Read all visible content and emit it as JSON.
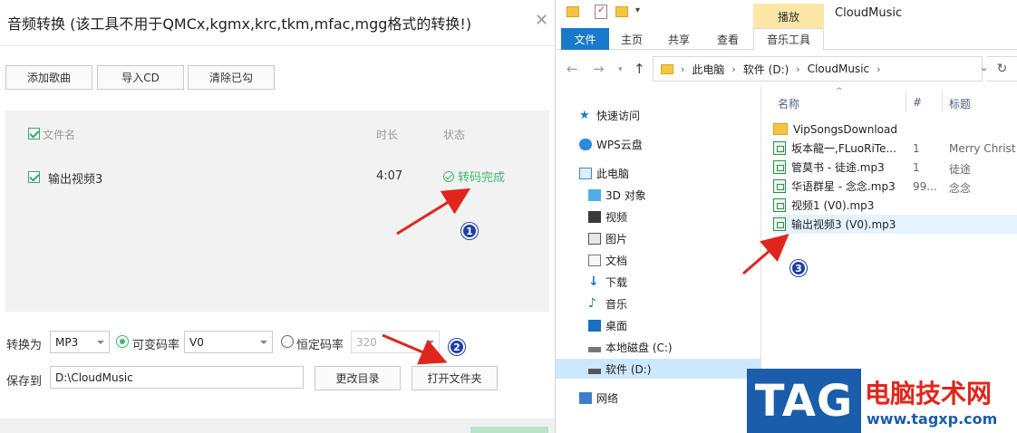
{
  "dialog": {
    "title": "音频转换 (该工具不用于QMCx,kgmx,krc,tkm,mfac,mgg格式的转换!)",
    "close": "✕",
    "buttons": {
      "add_song": "添加歌曲",
      "import_cd": "导入CD",
      "clear_checked": "清除已勾"
    },
    "list": {
      "headers": {
        "filename": "文件名",
        "duration": "时长",
        "status": "状态"
      },
      "rows": [
        {
          "name": "输出视频3",
          "duration": "4:07",
          "status": "转码完成"
        }
      ]
    },
    "convert_to_label": "转换为",
    "format": "MP3",
    "vbr_label": "可变码率",
    "vbr_value": "V0",
    "cbr_label": "恒定码率",
    "cbr_value": "320",
    "save_to_label": "保存到",
    "save_path": "D:\\CloudMusic",
    "change_dir": "更改目录",
    "open_folder": "打开文件夹"
  },
  "explorer": {
    "title": "CloudMusic",
    "context_tab": "播放",
    "ribbon_tabs": {
      "file": "文件",
      "home": "主页",
      "share": "共享",
      "view": "查看",
      "music_tools": "音乐工具"
    },
    "breadcrumb": [
      "此电脑",
      "软件 (D:)",
      "CloudMusic"
    ],
    "nav": {
      "quick_access": "快速访问",
      "wps_cloud": "WPS云盘",
      "this_pc": "此电脑",
      "objects3d": "3D 对象",
      "videos": "视频",
      "pictures": "图片",
      "documents": "文档",
      "downloads": "下载",
      "music": "音乐",
      "desktop": "桌面",
      "local_c": "本地磁盘 (C:)",
      "software_d": "软件 (D:)",
      "network": "网络"
    },
    "columns": {
      "name": "名称",
      "number": "#",
      "title": "标题"
    },
    "files": [
      {
        "name": "VipSongsDownload",
        "num": "",
        "title": ""
      },
      {
        "name": "坂本龍一,FLuoRiTe...",
        "num": "1",
        "title": "Merry Christ"
      },
      {
        "name": "管莫书 - 徒途.mp3",
        "num": "1",
        "title": "徒途"
      },
      {
        "name": "华语群星 - 念念.mp3",
        "num": "99...",
        "title": "念念"
      },
      {
        "name": "视频1 (V0).mp3",
        "num": "",
        "title": ""
      },
      {
        "name": "输出视频3 (V0).mp3",
        "num": "",
        "title": ""
      }
    ]
  },
  "annotations": {
    "b1": "1",
    "b2": "2",
    "b3": "3"
  },
  "watermark": {
    "tag": "TAG",
    "cn": "电脑技术网",
    "url": "www.tagxp.com"
  },
  "colors": {
    "accent_green": "#3db96d",
    "explorer_blue": "#1979ca",
    "arrow_red": "#e0261c",
    "badge_blue": "#1f3fa8"
  }
}
